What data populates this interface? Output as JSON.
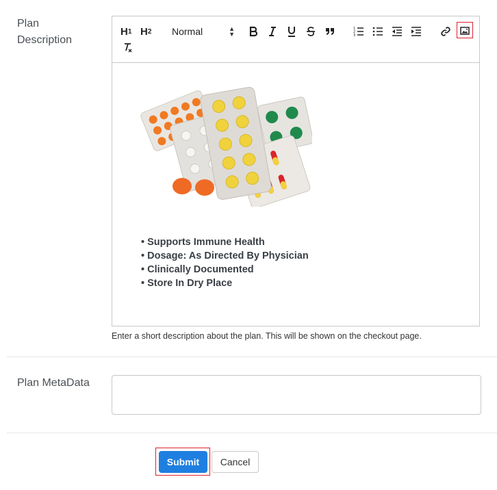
{
  "plan_description": {
    "label": "Plan Description",
    "toolbar": {
      "h1": "H",
      "h1_sub": "1",
      "h2": "H",
      "h2_sub": "2",
      "format_select": "Normal",
      "icons": [
        "bold-icon",
        "italic-icon",
        "underline-icon",
        "strike-icon",
        "blockquote-icon",
        "ordered-list-icon",
        "bullet-list-icon",
        "outdent-icon",
        "indent-icon",
        "link-icon",
        "image-icon",
        "clear-format-icon"
      ]
    },
    "content": {
      "image_alt": "Pill blister packs",
      "bullets": [
        "Supports Immune Health",
        "Dosage: As Directed By Physician",
        "Clinically Documented",
        "Store In Dry Place"
      ]
    },
    "help_text": "Enter a short description about the plan. This will be shown on the checkout page."
  },
  "plan_metadata": {
    "label": "Plan MetaData",
    "value": ""
  },
  "actions": {
    "submit_label": "Submit",
    "cancel_label": "Cancel"
  },
  "colors": {
    "primary": "#1f7fe0",
    "highlight": "#d9232e",
    "border": "#c8c8c8"
  }
}
